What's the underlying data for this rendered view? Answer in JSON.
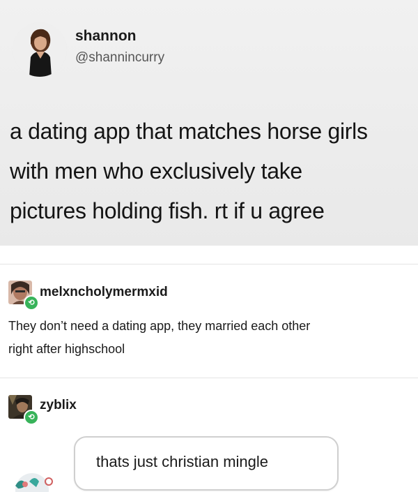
{
  "tweet": {
    "author_name": "shannon",
    "author_handle": "@shannincurry",
    "text_lines": [
      "a dating app that matches horse girls",
      "with men who exclusively take",
      "pictures holding fish. rt if u agree"
    ]
  },
  "comments": [
    {
      "username": "melxncholymermxid",
      "text_lines": [
        "They don’t need a dating app, they married each other",
        "right after highschool"
      ]
    },
    {
      "username": "zyblix"
    }
  ],
  "reply": {
    "text": "thats just christian mingle"
  },
  "colors": {
    "reblog_badge": "#38b35a",
    "tweet_background": "#ececec"
  }
}
